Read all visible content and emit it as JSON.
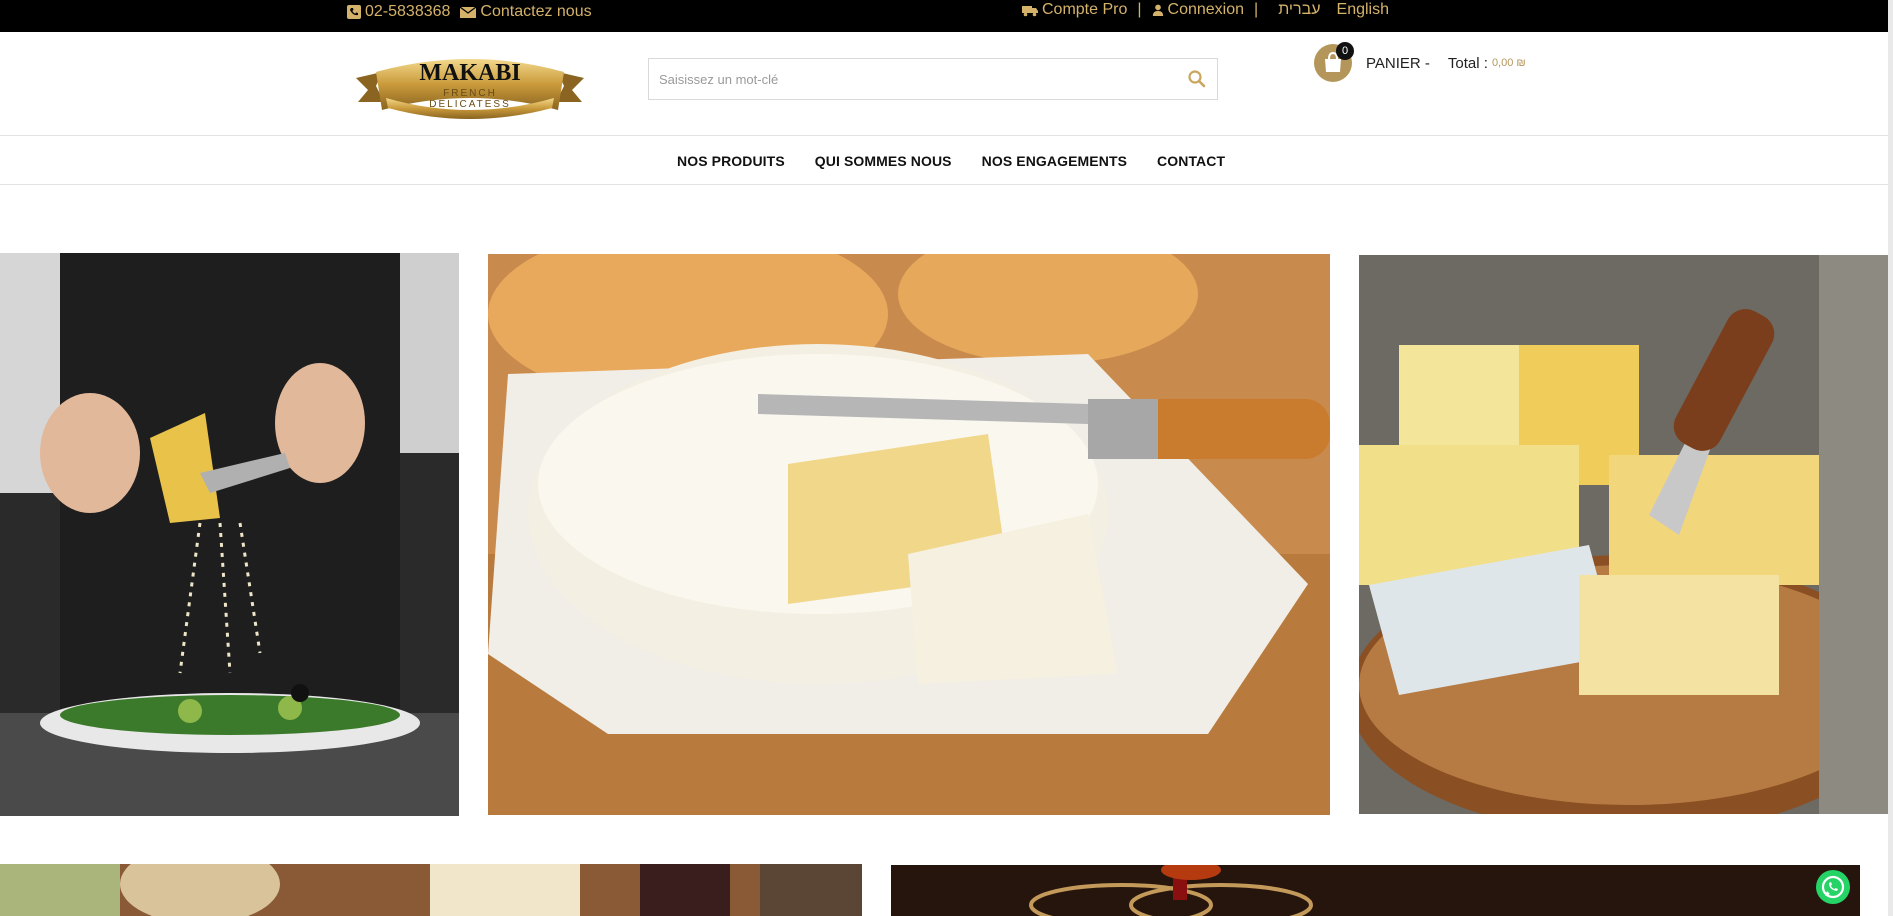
{
  "topbar": {
    "phone": "02-5838368",
    "contact": "Contactez nous",
    "pro_account": "Compte Pro",
    "login": "Connexion",
    "lang_he": "עברית",
    "lang_en": "English",
    "icons": [
      "phone-icon",
      "envelope-icon",
      "truck-icon",
      "user-icon"
    ]
  },
  "header": {
    "logo": {
      "brand": "MAKABI",
      "line1": "FRENCH",
      "line2": "DELICATESS"
    },
    "search": {
      "placeholder": "Saisissez un mot-clé",
      "value": ""
    },
    "cart": {
      "count": "0",
      "label": "PANIER -",
      "total_label": "Total :",
      "total_value": "0,00 ₪"
    }
  },
  "nav": {
    "items": [
      {
        "label": "NOS PRODUITS"
      },
      {
        "label": "QUI SOMMES NOUS"
      },
      {
        "label": "NOS ENGAGEMENTS"
      },
      {
        "label": "CONTACT"
      }
    ]
  },
  "banners": [
    {
      "subject": "grating cheese over salad"
    },
    {
      "subject": "camembert with baguette and knife"
    },
    {
      "subject": "assorted cheeses on wooden board"
    },
    {
      "subject": "cheese platter with wine"
    },
    {
      "subject": "red wine pouring into glasses"
    }
  ],
  "colors": {
    "gold": "#d4b26a",
    "cart_gold": "#b5965a",
    "topbar_bg": "#000000",
    "whatsapp": "#25d366"
  }
}
